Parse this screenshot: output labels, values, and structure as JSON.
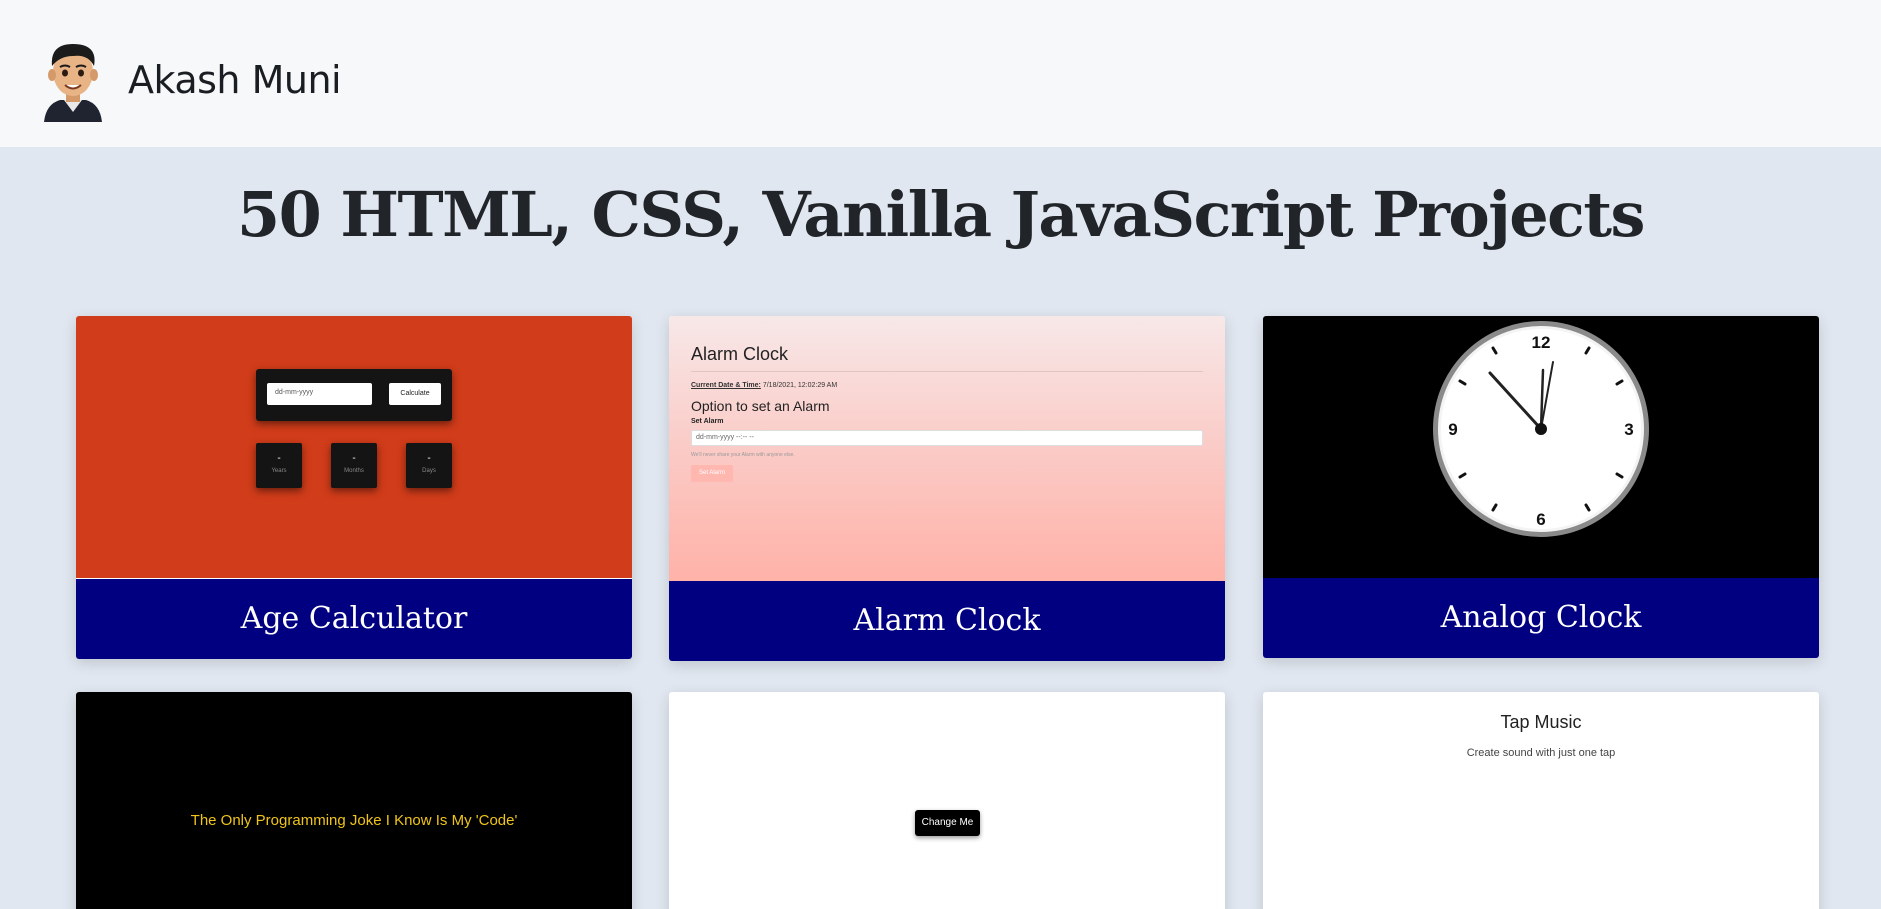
{
  "header": {
    "brand": "Akash Muni",
    "avatar_icon": "avatar-icon"
  },
  "page": {
    "title": "50 HTML, CSS, Vanilla JavaScript Projects"
  },
  "colors": {
    "caption_bg": "#000080",
    "page_bg": "#e1e7f0",
    "header_bg": "#f6f8fa"
  },
  "projects": [
    {
      "caption": "Age Calculator",
      "preview": {
        "date_placeholder": "dd-mm-yyyy",
        "calculate_label": "Calculate",
        "boxes": [
          {
            "value": "-",
            "label": "Years"
          },
          {
            "value": "-",
            "label": "Months"
          },
          {
            "value": "-",
            "label": "Days"
          }
        ]
      }
    },
    {
      "caption": "Alarm Clock",
      "preview": {
        "title": "Alarm Clock",
        "current_label": "Current Date & Time:",
        "current_value": "7/18/2021, 12:02:29 AM",
        "option_heading": "Option to set an Alarm",
        "set_alarm_label": "Set Alarm",
        "input_placeholder": "dd-mm-yyyy --:-- --",
        "note": "We'll never share your Alarm with anyone else.",
        "button_label": "Set Alarm"
      }
    },
    {
      "caption": "Analog Clock",
      "preview": {
        "numerals": [
          "12",
          "3",
          "6",
          "9"
        ]
      }
    },
    {
      "caption": "",
      "preview": {
        "text": "The Only Programming Joke I Know Is My 'Code'"
      }
    },
    {
      "caption": "",
      "preview": {
        "button_label": "Change Me"
      }
    },
    {
      "caption": "",
      "preview": {
        "title": "Tap Music",
        "subtitle": "Create sound with just one tap"
      }
    }
  ]
}
